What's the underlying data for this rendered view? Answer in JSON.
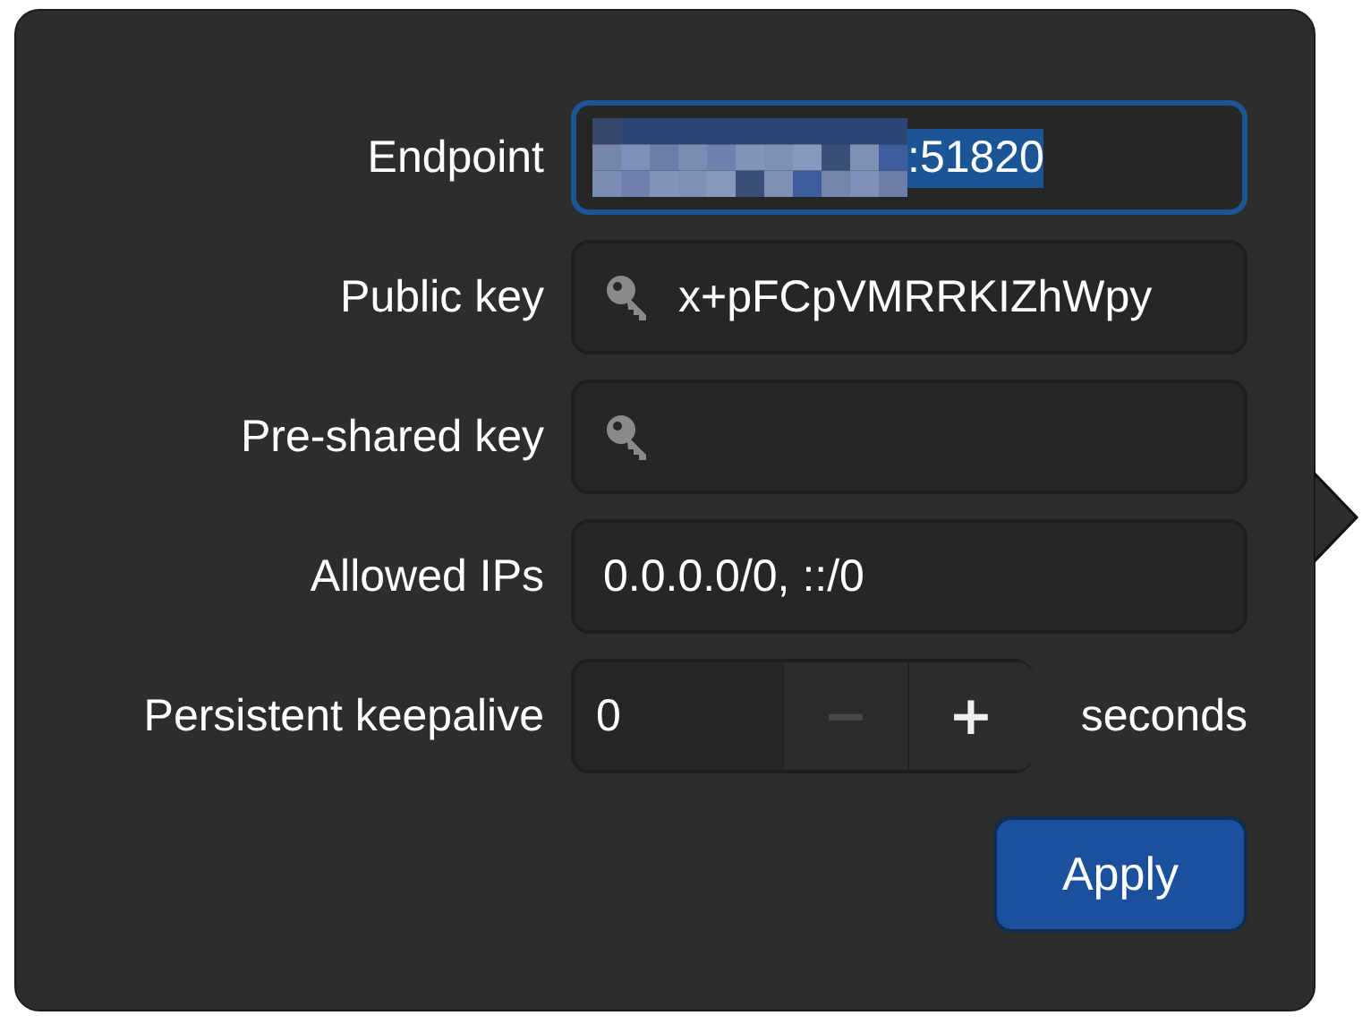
{
  "rows": [
    {
      "kind": "entry",
      "label": "Endpoint",
      "value": ":51820",
      "redacted": true,
      "focused": true,
      "text_selected": true,
      "key_icon": false
    },
    {
      "kind": "entry",
      "label": "Public key",
      "value": "x+pFCpVMRRKIZhWpy",
      "redacted": false,
      "focused": false,
      "text_selected": false,
      "key_icon": true
    },
    {
      "kind": "entry",
      "label": "Pre-shared key",
      "redacted": false,
      "focused": false,
      "key_icon": true
    },
    {
      "kind": "entry",
      "label": "Allowed IPs",
      "value": "0.0.0.0/0, ::/0",
      "redacted": false,
      "focused": false,
      "text_selected": false,
      "key_icon": false
    },
    {
      "kind": "spin",
      "label": "Persistent keepalive",
      "value": "0",
      "minus": "−",
      "plus": "+",
      "minus_disabled": true,
      "unit": "seconds"
    }
  ],
  "apply_button": {
    "label": "Apply"
  }
}
